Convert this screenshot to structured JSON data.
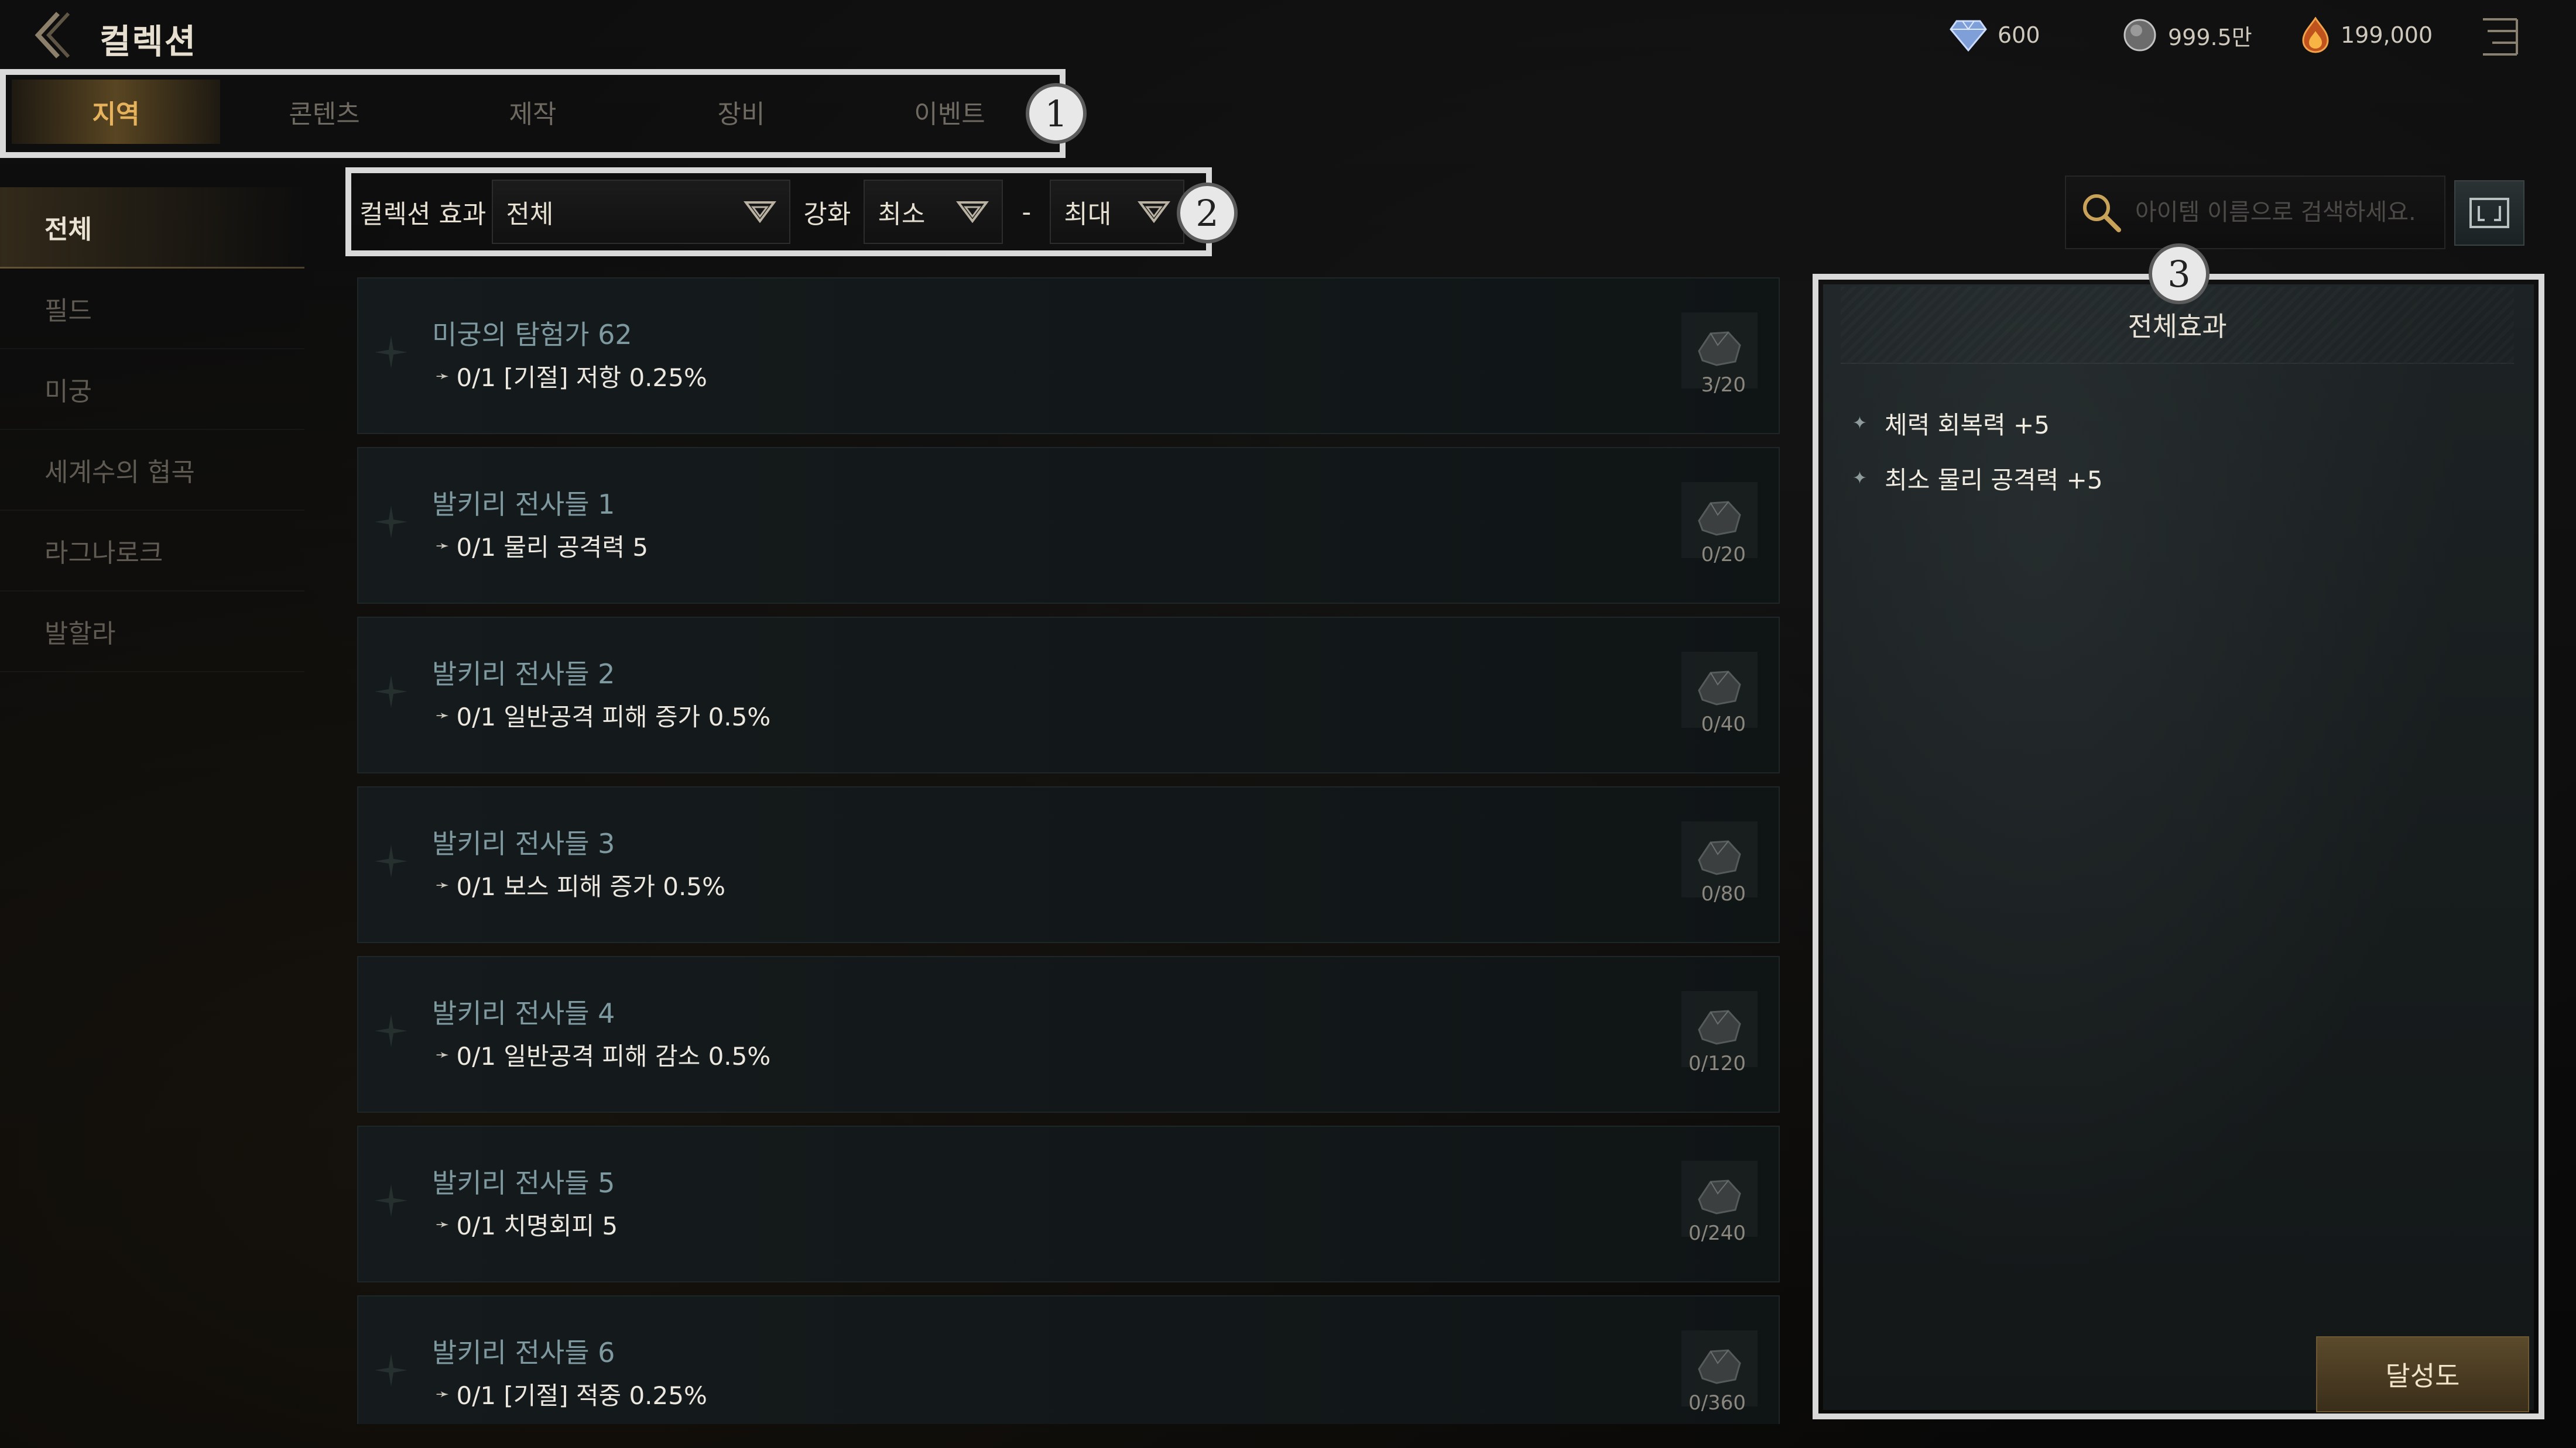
{
  "header": {
    "title": "컬렉션",
    "currencies": [
      {
        "icon": "diamond-gem-icon",
        "value": "600"
      },
      {
        "icon": "silver-coin-icon",
        "value": "999.5만"
      },
      {
        "icon": "red-fire-gem-icon",
        "value": "199,000"
      }
    ]
  },
  "tabs": [
    {
      "label": "지역",
      "active": true
    },
    {
      "label": "콘텐츠",
      "active": false
    },
    {
      "label": "제작",
      "active": false
    },
    {
      "label": "장비",
      "active": false
    },
    {
      "label": "이벤트",
      "active": false
    }
  ],
  "sidebar": {
    "items": [
      {
        "label": "전체",
        "active": true
      },
      {
        "label": "필드",
        "active": false
      },
      {
        "label": "미궁",
        "active": false
      },
      {
        "label": "세계수의 협곡",
        "active": false
      },
      {
        "label": "라그나로크",
        "active": false
      },
      {
        "label": "발할라",
        "active": false
      }
    ]
  },
  "filters": {
    "effect_label": "컬렉션 효과",
    "effect_value": "전체",
    "enhance_label": "강화",
    "min_value": "최소",
    "separator": "-",
    "max_value": "최대"
  },
  "search": {
    "placeholder": "아이템 이름으로 검색하세요."
  },
  "collections": [
    {
      "name": "미궁의 탐험가 62",
      "effect": "0/1 [기절] 저항 0.25%",
      "count": "3/20"
    },
    {
      "name": "발키리 전사들 1",
      "effect": "0/1 물리 공격력 5",
      "count": "0/20"
    },
    {
      "name": "발키리 전사들 2",
      "effect": "0/1 일반공격 피해 증가 0.5%",
      "count": "0/40"
    },
    {
      "name": "발키리 전사들 3",
      "effect": "0/1 보스 피해 증가 0.5%",
      "count": "0/80"
    },
    {
      "name": "발키리 전사들 4",
      "effect": "0/1 일반공격 피해 감소 0.5%",
      "count": "0/120"
    },
    {
      "name": "발키리 전사들 5",
      "effect": "0/1 치명회피 5",
      "count": "0/240"
    },
    {
      "name": "발키리 전사들 6",
      "effect": "0/1 [기절] 적중 0.25%",
      "count": "0/360"
    }
  ],
  "panel": {
    "title": "전체효과",
    "effects": [
      "체력 회복력 +5",
      "최소 물리 공격력 +5"
    ],
    "achievement_button": "달성도"
  },
  "annotations": [
    "1",
    "2",
    "3"
  ]
}
